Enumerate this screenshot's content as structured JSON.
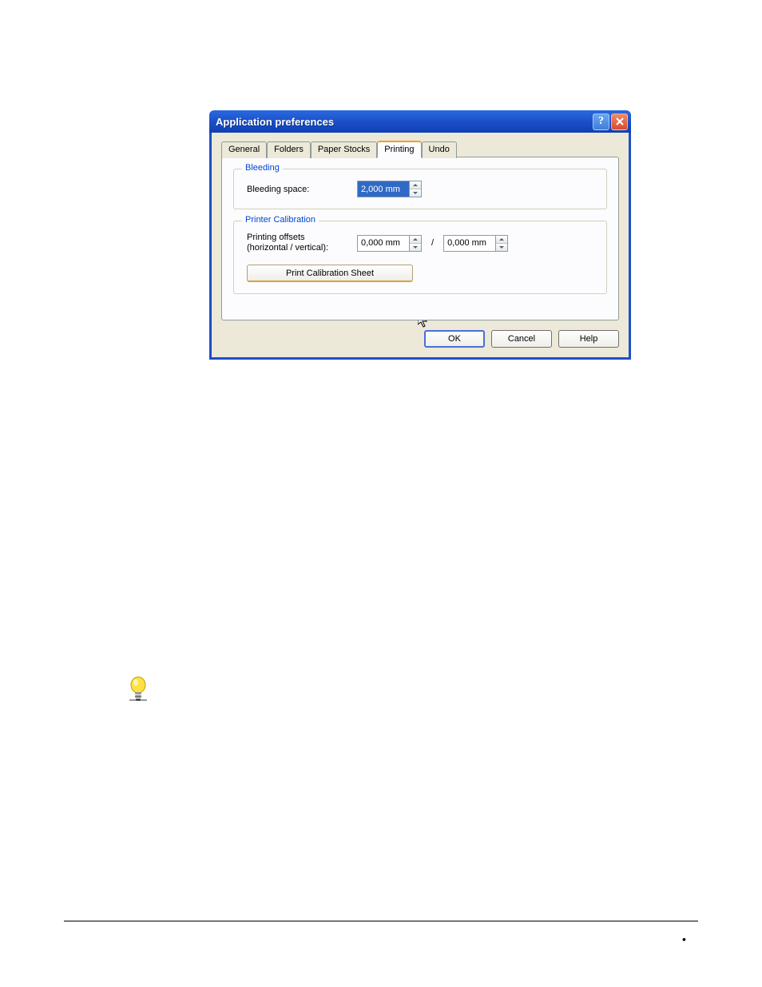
{
  "window": {
    "title": "Application preferences"
  },
  "tabs": {
    "general": "General",
    "folders": "Folders",
    "paper_stocks": "Paper Stocks",
    "printing": "Printing",
    "undo": "Undo"
  },
  "bleeding": {
    "legend": "Bleeding",
    "label": "Bleeding space:",
    "value": "2,000 mm"
  },
  "calibration": {
    "legend": "Printer Calibration",
    "offsets_label_l1": "Printing offsets",
    "offsets_label_l2": "(horizontal / vertical):",
    "h_value": "0,000 mm",
    "v_value": "0,000 mm",
    "separator": "/",
    "print_sheet": "Print Calibration Sheet"
  },
  "buttons": {
    "ok": "OK",
    "cancel": "Cancel",
    "help": "Help"
  }
}
